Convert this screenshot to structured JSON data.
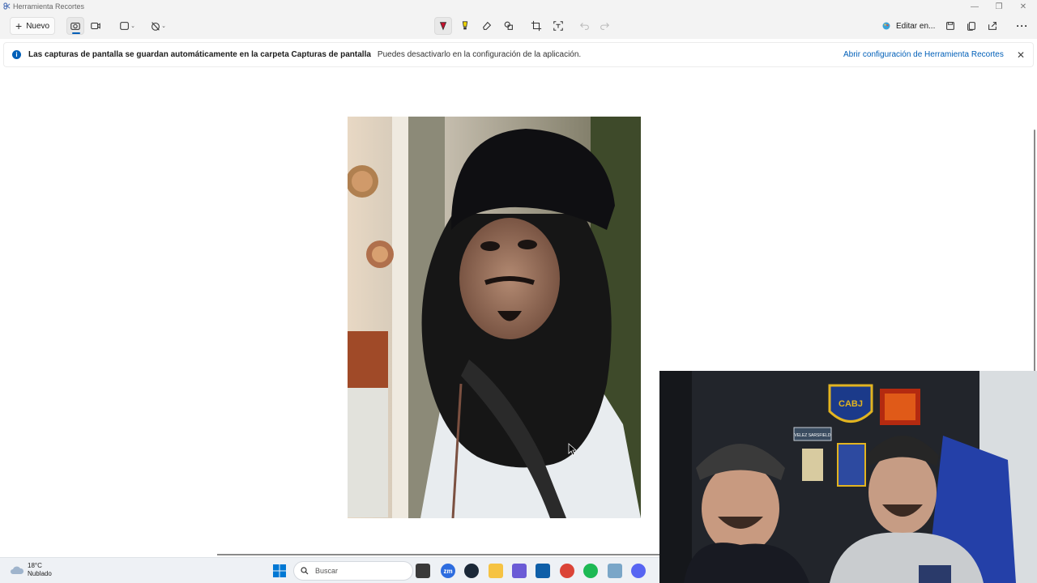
{
  "window": {
    "title": "Herramienta Recortes"
  },
  "toolbar": {
    "new_label": "Nuevo",
    "edit_in_label": "Editar en..."
  },
  "infobar": {
    "message_bold": "Las capturas de pantalla se guardan automáticamente en la carpeta Capturas de pantalla",
    "message": "Puedes desactivarlo en la configuración de la aplicación.",
    "link": "Abrir configuración de Herramienta Recortes"
  },
  "taskbar": {
    "weather_temp": "18°C",
    "weather_desc": "Nublado",
    "search_placeholder": "Buscar"
  },
  "webcam": {
    "badge_text": "CABJ",
    "sign_text": "VELEZ SARSFIELD"
  },
  "colors": {
    "accent": "#005fb8",
    "taskbar": "#eef1f5"
  },
  "icons": [
    "pen-icon",
    "highlighter-icon",
    "eraser-icon",
    "shapes-icon",
    "crop-icon",
    "text-actions-icon",
    "undo-icon",
    "redo-icon",
    "save-icon",
    "copy-icon",
    "share-icon",
    "more-icon"
  ]
}
